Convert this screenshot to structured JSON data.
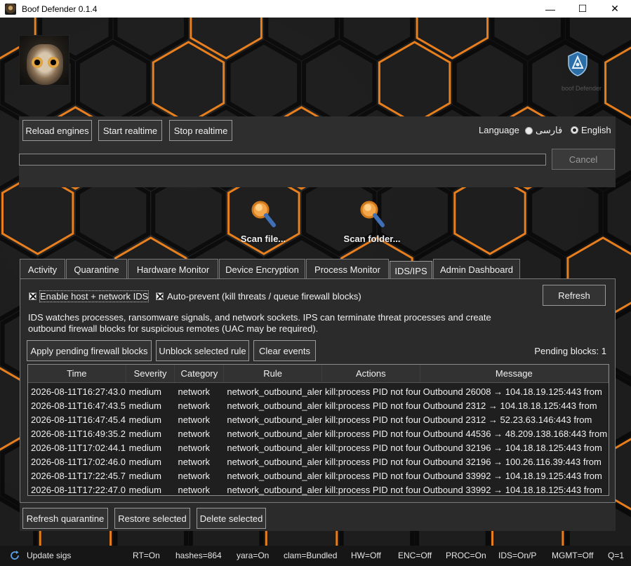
{
  "window": {
    "title": "Boof Defender 0.1.4",
    "icon": "owl-app-icon",
    "controls": {
      "minimize": "—",
      "maximize": "☐",
      "close": "✕"
    }
  },
  "header": {
    "logo_icon": "owl-logo",
    "badge_icon": "shield-badge-icon",
    "badge_text": "boof Defender"
  },
  "toolbar": {
    "reload_label": "Reload engines",
    "start_label": "Start realtime",
    "stop_label": "Stop realtime",
    "language_label": "Language",
    "lang_options": [
      {
        "label": "فارسی",
        "selected": false
      },
      {
        "label": "English",
        "selected": true
      }
    ]
  },
  "progress": {
    "value": 0,
    "cancel_label": "Cancel"
  },
  "scan": {
    "file_label": "Scan file...",
    "folder_label": "Scan folder..."
  },
  "tabs": [
    {
      "label": "Activity"
    },
    {
      "label": "Quarantine"
    },
    {
      "label": "Hardware Monitor"
    },
    {
      "label": "Device Encryption"
    },
    {
      "label": "Process Monitor"
    },
    {
      "label": "IDS/IPS",
      "active": true
    },
    {
      "label": "Admin Dashboard"
    }
  ],
  "ids": {
    "enable_label": "Enable host + network IDS",
    "enable_checked": true,
    "autoprevent_label": "Auto-prevent (kill threats / queue firewall blocks)",
    "autoprevent_checked": true,
    "refresh_label": "Refresh",
    "description": "IDS watches processes, ransomware signals, and network sockets. IPS can terminate threat processes and create outbound firewall blocks for suspicious remotes (UAC may be required).",
    "apply_label": "Apply pending firewall blocks",
    "unblock_label": "Unblock selected rule",
    "clear_label": "Clear events",
    "pending_text": "Pending blocks: 1",
    "columns": [
      "Time",
      "Severity",
      "Category",
      "Rule",
      "Actions",
      "Message"
    ],
    "rows": [
      [
        "2026-08-11T16:27:43.0",
        "medium",
        "network",
        "network_outbound_alert",
        "kill:process PID not found",
        "Outbound 26008 → 104.18.19.125:443 from"
      ],
      [
        "2026-08-11T16:47:43.5",
        "medium",
        "network",
        "network_outbound_alert",
        "kill:process PID not found",
        "Outbound 2312 → 104.18.18.125:443 from"
      ],
      [
        "2026-08-11T16:47:45.4",
        "medium",
        "network",
        "network_outbound_alert",
        "kill:process PID not found",
        "Outbound 2312 → 52.23.63.146:443 from"
      ],
      [
        "2026-08-11T16:49:35.2",
        "medium",
        "network",
        "network_outbound_alert",
        "kill:process PID not found",
        "Outbound 44536 → 48.209.138.168:443 from"
      ],
      [
        "2026-08-11T17:02:44.1",
        "medium",
        "network",
        "network_outbound_alert",
        "kill:process PID not found",
        "Outbound 32196 → 104.18.18.125:443 from"
      ],
      [
        "2026-08-11T17:02:46.0",
        "medium",
        "network",
        "network_outbound_alert",
        "kill:process PID not found",
        "Outbound 32196 → 100.26.116.39:443 from"
      ],
      [
        "2026-08-11T17:22:45.7",
        "medium",
        "network",
        "network_outbound_alert",
        "kill:process PID not found",
        "Outbound 33992 → 104.18.19.125:443 from"
      ],
      [
        "2026-08-11T17:22:47.0",
        "medium",
        "network",
        "network_outbound_alert",
        "kill:process PID not found",
        "Outbound 33992 → 104.18.18.125:443 from"
      ]
    ]
  },
  "quarantine_bar": {
    "refresh_label": "Refresh quarantine",
    "restore_label": "Restore selected",
    "delete_label": "Delete selected"
  },
  "status": {
    "update_label": "Update sigs",
    "items": [
      "RT=On",
      "hashes=864",
      "yara=On",
      "clam=Bundled",
      "HW=Off",
      "ENC=Off",
      "PROC=On",
      "IDS=On/P",
      "MGMT=Off",
      "Q=1"
    ]
  },
  "colors": {
    "accent_orange": "#ff8a1e",
    "progress_blue": "#3a7bd5"
  }
}
